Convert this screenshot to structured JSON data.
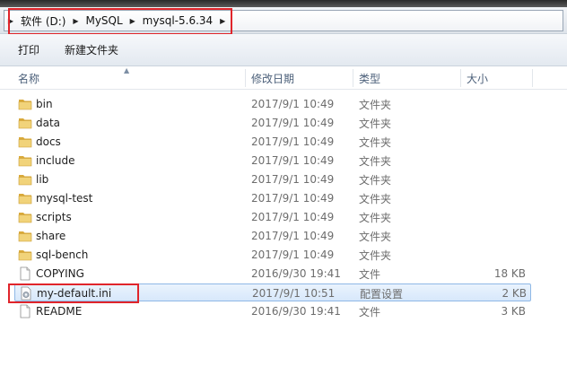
{
  "address": {
    "segments": [
      "软件 (D:)",
      "MySQL",
      "mysql-5.6.34"
    ]
  },
  "toolbar": {
    "print_label": "打印",
    "new_folder_label": "新建文件夹"
  },
  "columns": {
    "name": "名称",
    "date": "修改日期",
    "type": "类型",
    "size": "大小"
  },
  "files": [
    {
      "name": "bin",
      "date": "2017/9/1 10:49",
      "type": "文件夹",
      "size": "",
      "icon": "folder-icon"
    },
    {
      "name": "data",
      "date": "2017/9/1 10:49",
      "type": "文件夹",
      "size": "",
      "icon": "folder-icon"
    },
    {
      "name": "docs",
      "date": "2017/9/1 10:49",
      "type": "文件夹",
      "size": "",
      "icon": "folder-icon"
    },
    {
      "name": "include",
      "date": "2017/9/1 10:49",
      "type": "文件夹",
      "size": "",
      "icon": "folder-icon"
    },
    {
      "name": "lib",
      "date": "2017/9/1 10:49",
      "type": "文件夹",
      "size": "",
      "icon": "folder-icon"
    },
    {
      "name": "mysql-test",
      "date": "2017/9/1 10:49",
      "type": "文件夹",
      "size": "",
      "icon": "folder-icon"
    },
    {
      "name": "scripts",
      "date": "2017/9/1 10:49",
      "type": "文件夹",
      "size": "",
      "icon": "folder-icon"
    },
    {
      "name": "share",
      "date": "2017/9/1 10:49",
      "type": "文件夹",
      "size": "",
      "icon": "folder-icon"
    },
    {
      "name": "sql-bench",
      "date": "2017/9/1 10:49",
      "type": "文件夹",
      "size": "",
      "icon": "folder-icon"
    },
    {
      "name": "COPYING",
      "date": "2016/9/30 19:41",
      "type": "文件",
      "size": "18 KB",
      "icon": "document-icon"
    },
    {
      "name": "my-default.ini",
      "date": "2017/9/1 10:51",
      "type": "配置设置",
      "size": "2 KB",
      "icon": "settings-file-icon",
      "selected": true
    },
    {
      "name": "README",
      "date": "2016/9/30 19:41",
      "type": "文件",
      "size": "3 KB",
      "icon": "document-icon"
    }
  ],
  "colors": {
    "highlight_box": "#e0252b",
    "selection_border": "#8fb8e6",
    "header_text": "#4c607a",
    "folder_yellow": "#e8c45a"
  }
}
